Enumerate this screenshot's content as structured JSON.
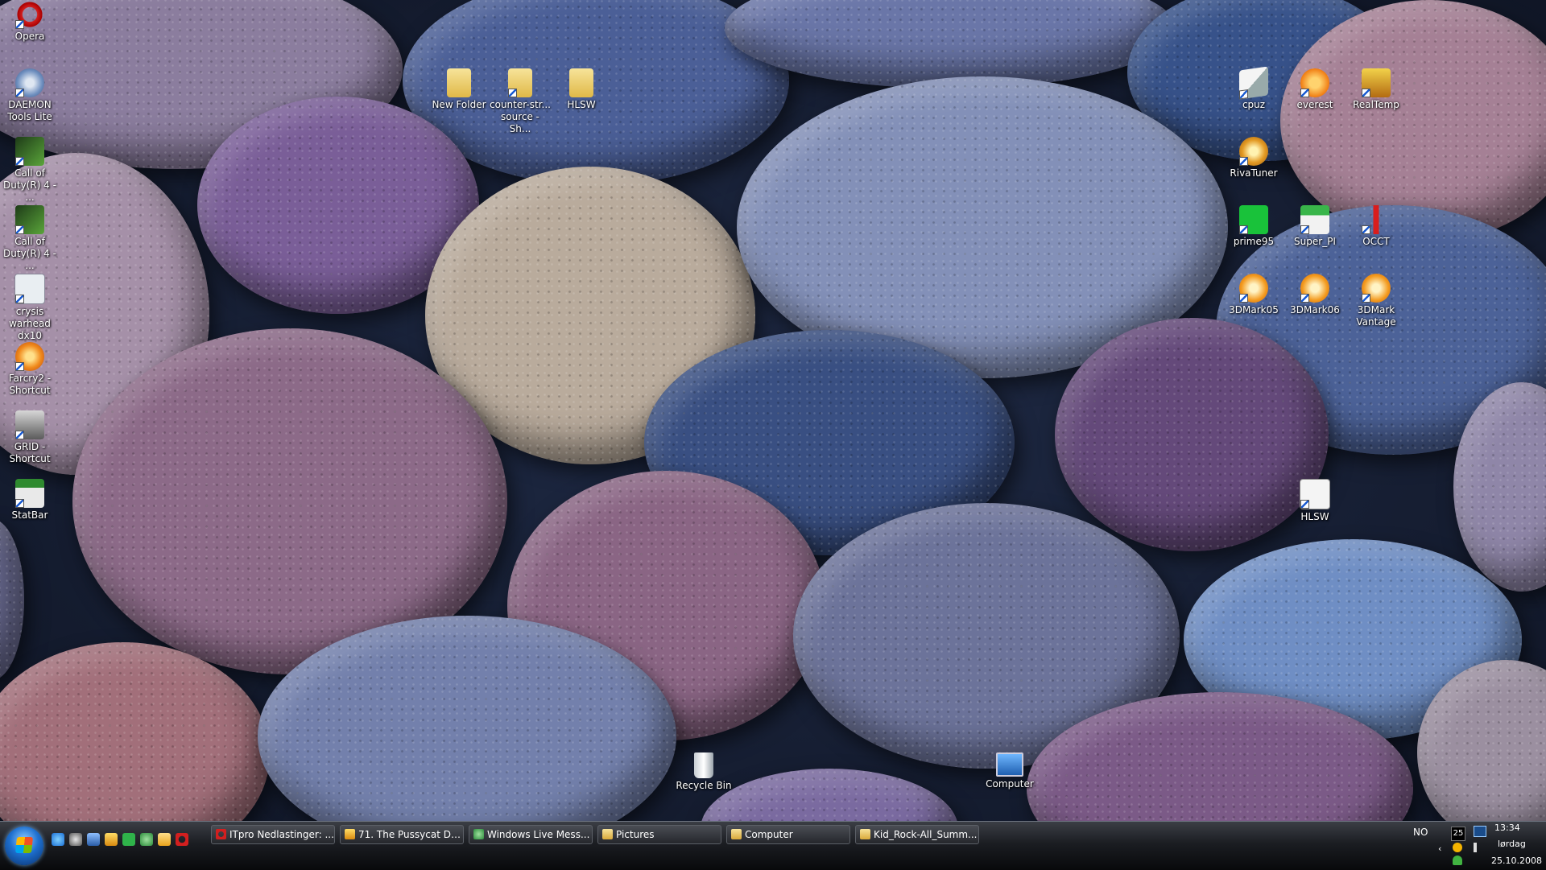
{
  "desktop_icons": {
    "opera": "Opera",
    "daemon": "DAEMON Tools Lite",
    "cod1": "Call of Duty(R) 4 - ...",
    "cod2": "Call of Duty(R) 4 - ...",
    "crysis": "crysis warhead dx10",
    "farcry": "Farcry2 - Shortcut",
    "grid": "GRID - Shortcut",
    "statbar": "StatBar",
    "new_folder": "New Folder",
    "counter_strike": "counter-str... source - Sh...",
    "hlsw_folder": "HLSW",
    "cpuz": "cpuz",
    "everest": "everest",
    "realtemp": "RealTemp",
    "rivatuner": "RivaTuner",
    "prime95": "prime95",
    "superpi": "Super_PI",
    "occt": "OCCT",
    "3dmark05": "3DMark05",
    "3dmark06": "3DMark06",
    "3dmarkvantage": "3DMark Vantage",
    "hlsw": "HLSW",
    "recycle_bin": "Recycle Bin",
    "computer": "Computer"
  },
  "taskbar": {
    "tasks": [
      "ITpro Nedlastinger: ...",
      "71. The Pussycat Do...",
      "Windows Live Mess...",
      "Pictures",
      "Computer",
      "Kid_Rock-All_Summ..."
    ],
    "language": "NO",
    "tray_badge": "25",
    "time": "13:34",
    "day": "lørdag",
    "date": "25.10.2008"
  },
  "colors": {
    "taskbar": "#1b1d22",
    "icon_label": "#ffffff"
  }
}
